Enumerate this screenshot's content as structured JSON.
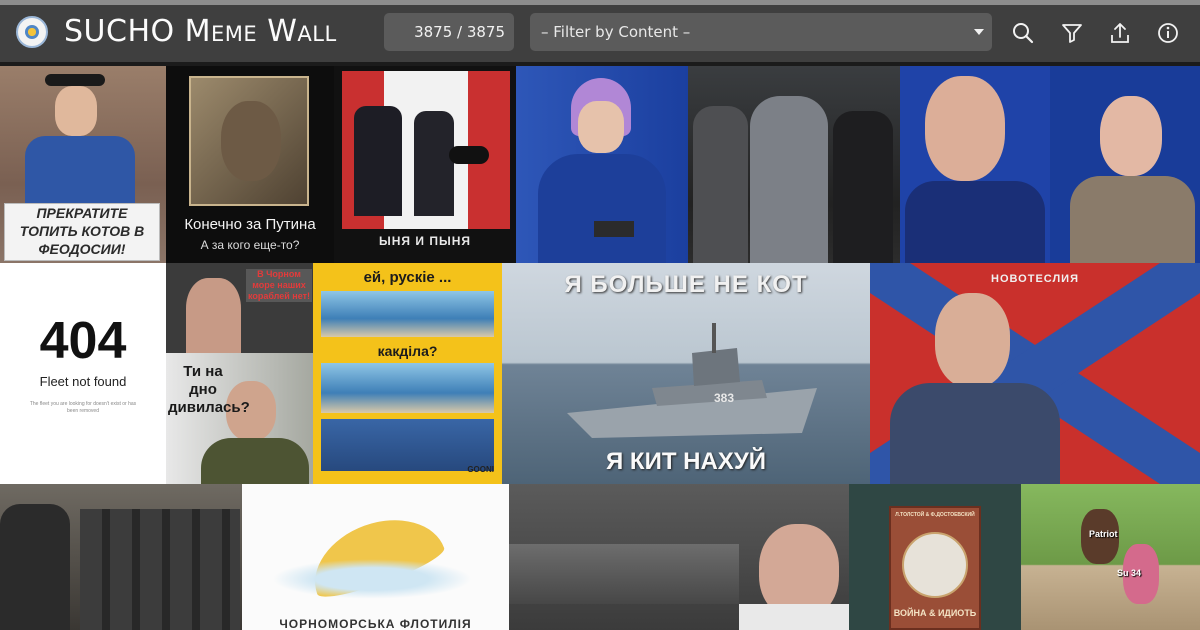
{
  "header": {
    "title": "SUCHO Meme Wall",
    "counter": "3875 / 3875",
    "filter_placeholder": "– Filter by Content –"
  },
  "icons": [
    "sucho-logo-icon",
    "search-icon",
    "filter-icon",
    "upload-icon",
    "info-icon"
  ],
  "memes": {
    "t1_text": "ПРЕКРАТИТЕ ТОПИТЬ КОТОВ В ФЕОДОСИИ!",
    "t2_line1": "Конечно за Путина",
    "t2_line2": "А за кого еще-то?",
    "t3_text": "ЫНЯ И ПЫНЯ",
    "t7_code": "404",
    "t7_title": "Fleet not found",
    "t7_sub": "The fleet you are looking for doesn't exist or has been removed",
    "t8_text": "В Чорном море наших кораблей нет!",
    "t9_text": "Ти на дно дивилась?",
    "t10_top": "ей, рускіе ...",
    "t10_mid": "какділа?",
    "t10_brand": "GOONI",
    "t11_top": "Я БОЛЬШЕ НЕ КОТ",
    "t11_bottom": "Я КИТ НАХУЙ",
    "t11_hull": "383",
    "t12_banner": "НОВОТЕСЛИЯ",
    "t14_text": "ЧОРНОМОРСЬКА ФЛОТИЛІЯ",
    "t16_book_top": "Л.ТОЛСТОЙ & Ф.ДОСТОЕВСКИЙ",
    "t16_book_title": "ВОЙНА & ИДИОТЬ",
    "t17_label1": "Patriot",
    "t17_label2": "Su 34"
  },
  "colors": {
    "header_bg": "#3f3f3f",
    "control_bg": "#5b5b5b",
    "text_light": "#fbfbfb"
  }
}
